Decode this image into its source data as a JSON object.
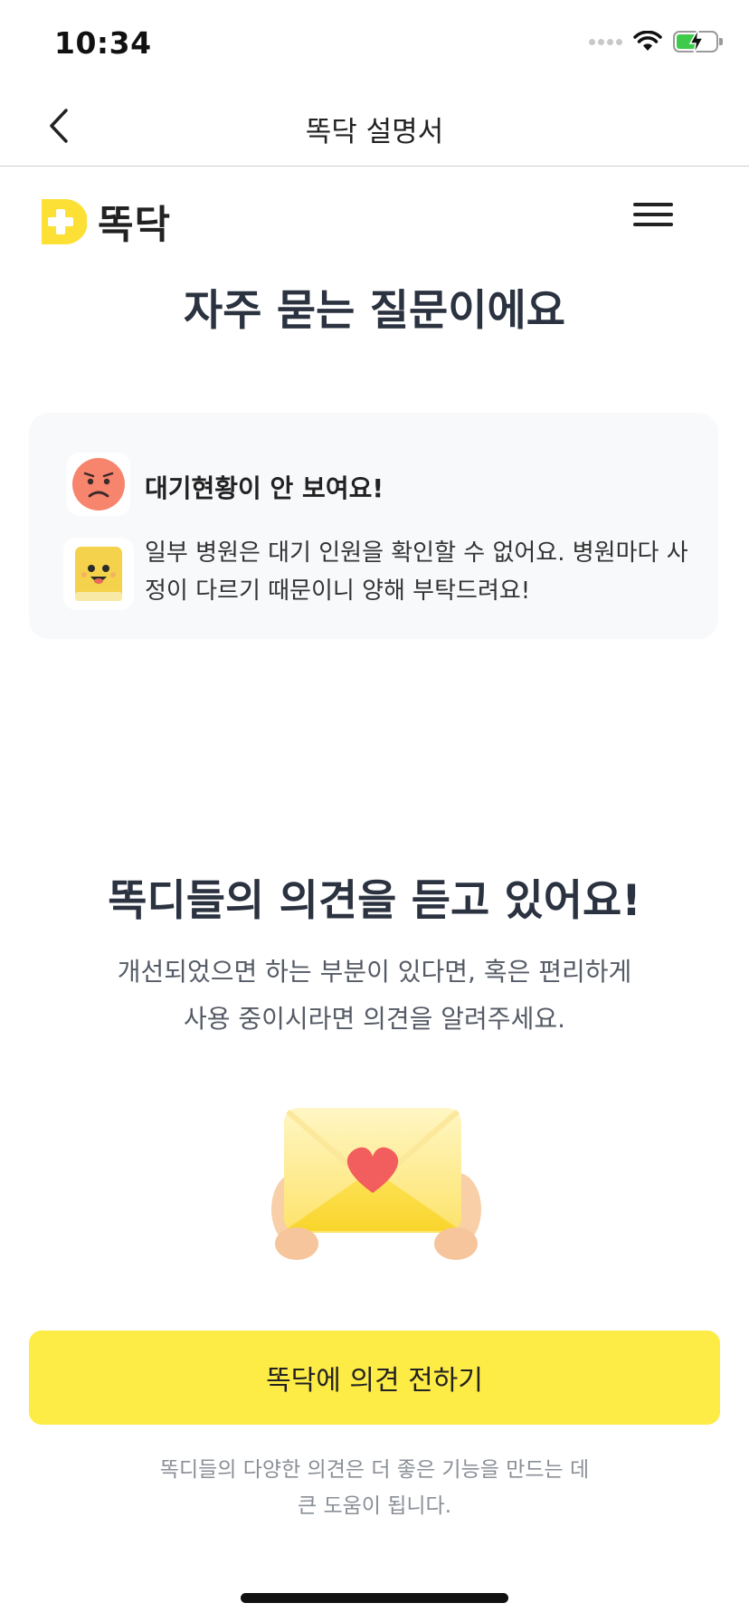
{
  "status_bar": {
    "time": "10:34"
  },
  "nav": {
    "title": "똑닥 설명서"
  },
  "site_header": {
    "logo_text": "똑닥"
  },
  "faq": {
    "heading": "자주 묻는 질문이에요",
    "question": "대기현황이 안 보여요!",
    "answer_line1": "일부 병원은 대기 인원을 확인할 수 없어요. 병원마다 사",
    "answer_line2": "정이 다르기 때문이니 양해 부탁드려요!"
  },
  "feedback": {
    "heading": "똑디들의 의견을 듣고 있어요!",
    "desc_line1": "개선되었으면 하는 부분이 있다면, 혹은 편리하게",
    "desc_line2": "사용 중이시라면 의견을 알려주세요.",
    "button_label": "똑닥에 의견 전하기",
    "note_line1": "똑디들의 다양한 의견은 더 좋은 기능을 만드는 데",
    "note_line2": "큰 도움이 됩니다."
  },
  "colors": {
    "brand_yellow": "#fdeb46",
    "heading_text": "#2b3240",
    "card_background": "#f8f9fb",
    "battery_green": "#3ecb4c"
  }
}
